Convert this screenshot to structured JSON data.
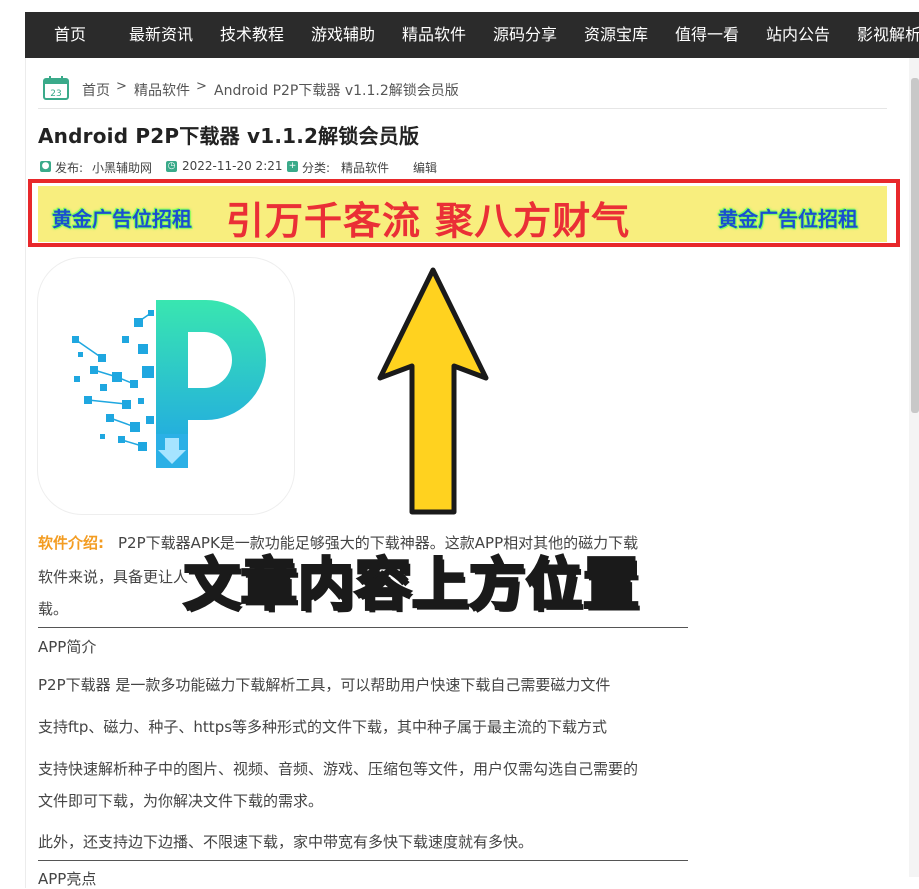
{
  "nav": {
    "items": [
      "首页",
      "最新资讯",
      "技术教程",
      "游戏辅助",
      "精品软件",
      "源码分享",
      "资源宝库",
      "值得一看",
      "站内公告",
      "影视解析"
    ]
  },
  "breadcrumb": {
    "calendar_day": "23",
    "home": "首页",
    "sep": ">",
    "category": "精品软件",
    "current": "Android P2P下载器 v1.1.2解锁会员版"
  },
  "article": {
    "title": "Android P2P下载器 v1.1.2解锁会员版",
    "meta": {
      "author_label": "发布:",
      "author": "小黑辅助网",
      "date": "2022-11-20 2:21",
      "category_label": "分类:",
      "category": "精品软件",
      "edit": "编辑"
    }
  },
  "ad": {
    "left": "黄金广告位招租",
    "main": "引万千客流  聚八方财气",
    "right": "黄金广告位招租"
  },
  "overlay": {
    "text": "文章内容上方位置"
  },
  "content": {
    "intro_label": "软件介绍:",
    "intro_line1": "P2P下载器APK是一款功能足够强大的下载神器。这款APP相对其他的磁力下载",
    "intro_line2": "软件来说，具备更让人",
    "intro_line3": "载。",
    "section1": "APP简介",
    "p1": "P2P下载器 是一款多功能磁力下载解析工具，可以帮助用户快速下载自己需要磁力文件",
    "p2": "支持ftp、磁力、种子、https等多种形式的文件下载，其中种子属于最主流的下载方式",
    "p3a": "支持快速解析种子中的图片、视频、音频、游戏、压缩包等文件，用户仅需勾选自己需要的",
    "p3b": "文件即可下载，为你解决文件下载的需求。",
    "p4": "此外，还支持边下边播、不限速下载，家中带宽有多快下载速度就有多快。",
    "section2": "APP亮点"
  },
  "colors": {
    "nav_bg": "#2b2b2b",
    "accent_green": "#3aaa8a",
    "ad_border": "#e8282b",
    "ad_bg": "#f8ee7e",
    "orange": "#f39c21",
    "overlay_yellow": "#ffd21f"
  }
}
